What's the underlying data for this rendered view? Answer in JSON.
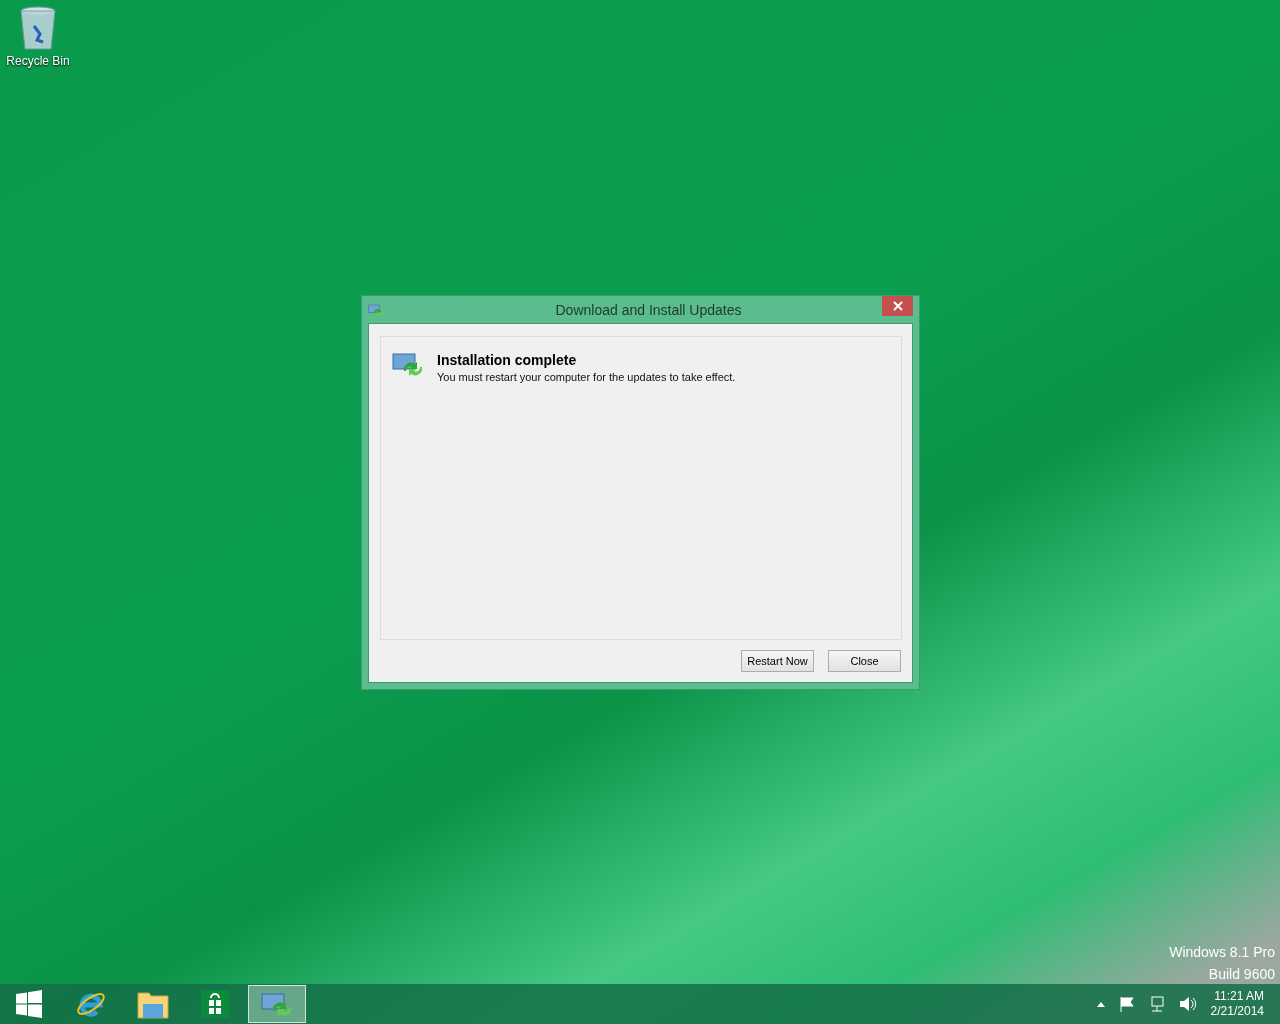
{
  "desktop": {
    "icons": [
      {
        "kind": "recycle-bin",
        "label": "Recycle Bin"
      }
    ],
    "version_lines": [
      "Windows 8.1 Pro",
      "Build 9600"
    ]
  },
  "dialog": {
    "title": "Download and Install Updates",
    "heading": "Installation complete",
    "message": "You must restart your computer for the updates to take effect.",
    "buttons": [
      {
        "label": "Restart Now"
      },
      {
        "label": "Close"
      }
    ]
  },
  "taskbar": {
    "apps": [
      {
        "kind": "start",
        "selected": false
      },
      {
        "kind": "browser",
        "selected": false
      },
      {
        "kind": "folder",
        "selected": false
      },
      {
        "kind": "store",
        "selected": false
      },
      {
        "kind": "update",
        "selected": true
      }
    ],
    "clock": {
      "time": "11:21 AM",
      "date": "2/21/2014"
    }
  }
}
